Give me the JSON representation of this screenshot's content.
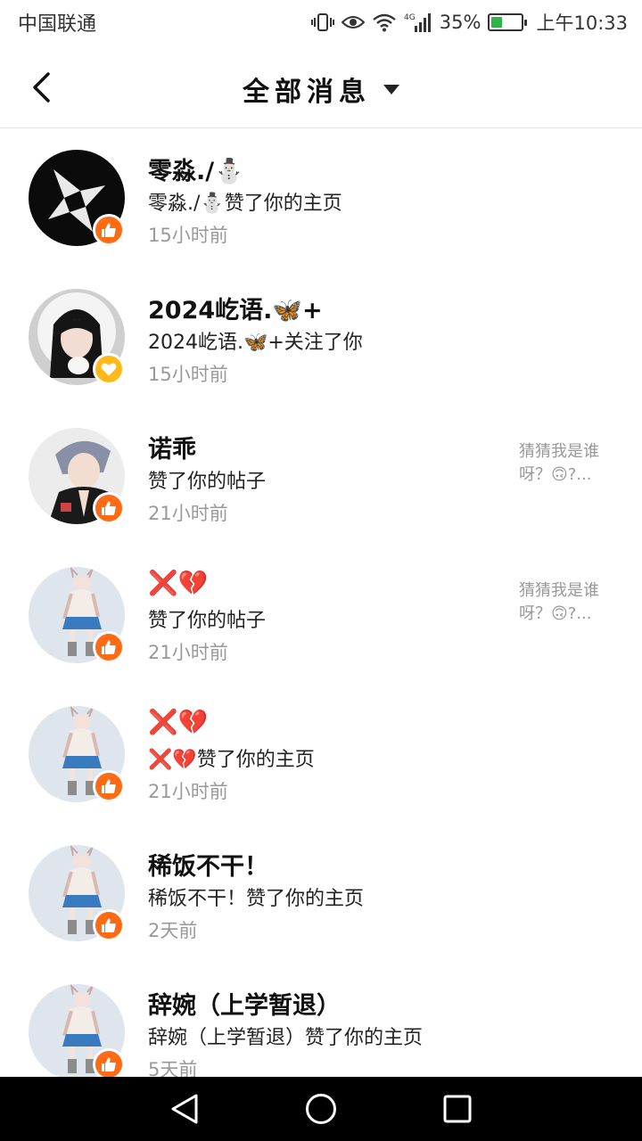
{
  "status_bar": {
    "carrier": "中国联通",
    "network": "4G",
    "battery_percent": "35%",
    "battery_level": 0.35,
    "time": "上午10:33",
    "icons": [
      "vibrate-icon",
      "eye-comfort-icon",
      "wifi-icon",
      "signal-icon",
      "battery-icon"
    ]
  },
  "header": {
    "title": "全部消息",
    "back_icon": "chevron-left-icon",
    "dropdown_icon": "caret-down-icon"
  },
  "notifications": [
    {
      "name": "零淼./⛄",
      "desc": "零淼./⛄赞了你的主页",
      "time": "15小时前",
      "badge": "like",
      "avatar": "black-star"
    },
    {
      "name": "2024屹语.🦋+",
      "desc": "2024屹语.🦋+关注了你",
      "time": "15小时前",
      "badge": "heart",
      "avatar": "girl-fur-hood"
    },
    {
      "name": "诺乖",
      "desc": "赞了你的帖子",
      "time": "21小时前",
      "badge": "like",
      "avatar": "anime-boy",
      "preview": "猜猜我是谁呀？🙃?..."
    },
    {
      "name": "❌💔",
      "desc": "赞了你的帖子",
      "time": "21小时前",
      "badge": "like",
      "avatar": "default-girl",
      "preview": "猜猜我是谁呀？🙃?..."
    },
    {
      "name": "❌💔",
      "desc": "❌💔赞了你的主页",
      "time": "21小时前",
      "badge": "like",
      "avatar": "default-girl"
    },
    {
      "name": "稀饭不干！",
      "desc": "稀饭不干！赞了你的主页",
      "time": "2天前",
      "badge": "like",
      "avatar": "default-girl"
    },
    {
      "name": "辞婉（上学暂退）",
      "desc": "辞婉（上学暂退）赞了你的主页",
      "time": "5天前",
      "badge": "like",
      "avatar": "default-girl"
    }
  ],
  "nav_bar": {
    "back": "triangle-back-icon",
    "home": "circle-home-icon",
    "recents": "square-recents-icon"
  },
  "colors": {
    "like_badge": "#ff6a14",
    "heart_badge": "#ffba1a",
    "battery": "#2fb34a",
    "avatar_bg": "#dfe5ed"
  }
}
